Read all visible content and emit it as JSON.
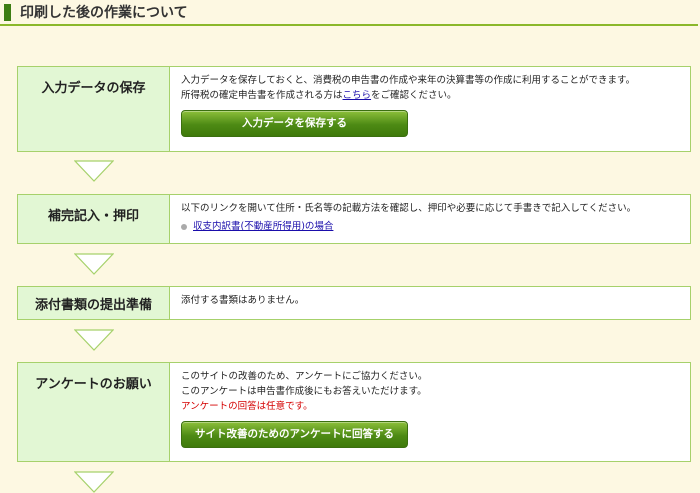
{
  "page": {
    "title": "印刷した後の作業について"
  },
  "steps": [
    {
      "label": "入力データの保存",
      "lines": [
        "入力データを保存しておくと、消費税の申告書の作成や来年の決算書等の作成に利用することができます。"
      ],
      "line2_pre": "所得税の確定申告書を作成される方は",
      "line2_link": "こちら",
      "line2_post": "をご確認ください。",
      "button": "入力データを保存する"
    },
    {
      "label": "補完記入・押印",
      "lines": [
        "以下のリンクを開いて住所・氏名等の記載方法を確認し、押印や必要に応じて手書きで記入してください。"
      ],
      "link": "収支内訳書(不動産所得用)の場合"
    },
    {
      "label": "添付書類の提出準備",
      "lines": [
        "添付する書類はありません。"
      ]
    },
    {
      "label": "アンケートのお願い",
      "lines": [
        "このサイトの改善のため、アンケートにご協力ください。",
        "このアンケートは申告書作成後にもお答えいただけます。"
      ],
      "note": "アンケートの回答は任意です。",
      "button": "サイト改善のためのアンケートに回答する"
    }
  ],
  "colors": {
    "accent": "#8bb82b",
    "label_bg": "#e2f7d4",
    "button": "#4d8a14",
    "note": "#d40000"
  }
}
